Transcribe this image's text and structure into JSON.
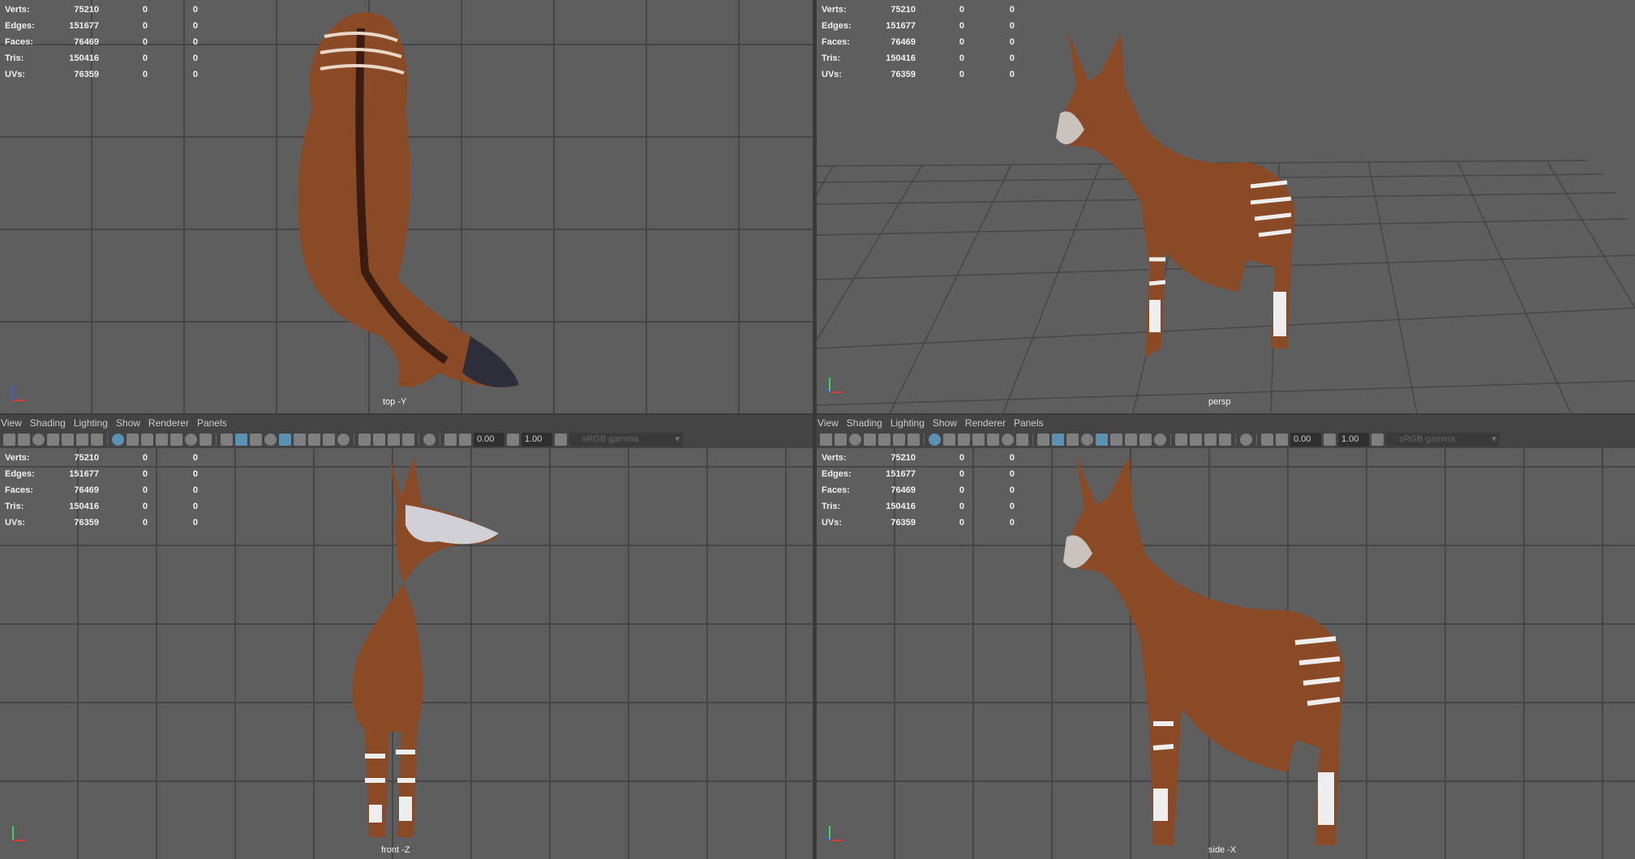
{
  "stats": [
    {
      "label": "Verts:",
      "value": "75210",
      "sel": "0",
      "tri": "0"
    },
    {
      "label": "Edges:",
      "value": "151677",
      "sel": "0",
      "tri": "0"
    },
    {
      "label": "Faces:",
      "value": "76469",
      "sel": "0",
      "tri": "0"
    },
    {
      "label": "Tris:",
      "value": "150416",
      "sel": "0",
      "tri": "0"
    },
    {
      "label": "UVs:",
      "value": "76359",
      "sel": "0",
      "tri": "0"
    }
  ],
  "panes": {
    "top_left": {
      "camera": "top -Y"
    },
    "top_right": {
      "camera": "persp"
    },
    "bottom_left": {
      "camera": "front -Z"
    },
    "bottom_right": {
      "camera": "side -X"
    }
  },
  "menu": [
    "View",
    "Shading",
    "Lighting",
    "Show",
    "Renderer",
    "Panels"
  ],
  "toolbar": {
    "exposure": "0.00",
    "gamma": "1.00",
    "color_space": "sRGB gamma",
    "icons": [
      "camera-icon",
      "camera-lock-icon",
      "camera-attr-icon",
      "bookmark-icon",
      "image-plane-icon",
      "pan-zoom-icon",
      "grease-pencil-icon",
      "grid-icon",
      "film-gate-icon",
      "resolution-gate-icon",
      "gate-mask-icon",
      "field-chart-icon",
      "safe-action-icon",
      "safe-title-icon",
      "wireframe-icon",
      "smooth-shade-icon",
      "wireframe-on-shaded-icon",
      "default-material-icon",
      "textured-icon",
      "lights-icon",
      "shadows-icon",
      "ambient-occlusion-icon",
      "motion-blur-icon",
      "anti-alias-icon",
      "depth-of-field-icon",
      "isolate-select-icon",
      "xray-icon",
      "xray-joints-icon",
      "xray-components-icon",
      "exposure-icon",
      "gamma-icon",
      "color-management-icon"
    ],
    "active_icons": [
      "grid-icon",
      "smooth-shade-icon",
      "textured-icon"
    ]
  },
  "colors": {
    "viewport": "#5e5e5e",
    "grid": "#474747",
    "chrome": "#444444",
    "active": "#5f9fc4",
    "okapi": "#8a4a26"
  }
}
